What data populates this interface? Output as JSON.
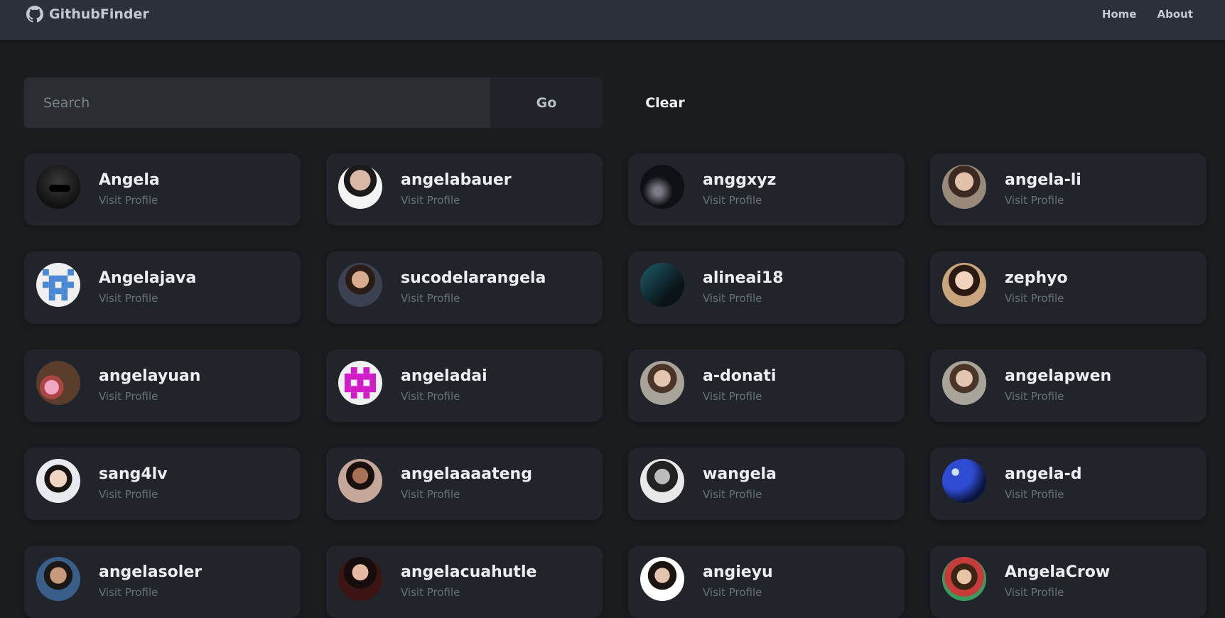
{
  "navbar": {
    "brand": "GithubFinder",
    "links": [
      {
        "label": "Home"
      },
      {
        "label": "About"
      }
    ]
  },
  "search": {
    "placeholder": "Search",
    "value": "",
    "go_label": "Go",
    "clear_label": "Clear"
  },
  "users": [
    {
      "login": "Angela",
      "link": "Visit Profile",
      "avatar": "photo-dark"
    },
    {
      "login": "angelabauer",
      "link": "Visit Profile",
      "avatar": "light"
    },
    {
      "login": "anggxyz",
      "link": "Visit Profile",
      "avatar": "night"
    },
    {
      "login": "angela-li",
      "link": "Visit Profile",
      "avatar": "portrait"
    },
    {
      "login": "Angelajava",
      "link": "Visit Profile",
      "avatar": "identicon-blue"
    },
    {
      "login": "sucodelarangela",
      "link": "Visit Profile",
      "avatar": "portrait2"
    },
    {
      "login": "alineai18",
      "link": "Visit Profile",
      "avatar": "teal"
    },
    {
      "login": "zephyo",
      "link": "Visit Profile",
      "avatar": "warm"
    },
    {
      "login": "angelayuan",
      "link": "Visit Profile",
      "avatar": "pink"
    },
    {
      "login": "angeladai",
      "link": "Visit Profile",
      "avatar": "identicon-magenta"
    },
    {
      "login": "a-donati",
      "link": "Visit Profile",
      "avatar": "soft"
    },
    {
      "login": "angelapwen",
      "link": "Visit Profile",
      "avatar": "soft"
    },
    {
      "login": "sang4lv",
      "link": "Visit Profile",
      "avatar": "kid"
    },
    {
      "login": "angelaaaateng",
      "link": "Visit Profile",
      "avatar": "smile"
    },
    {
      "login": "wangela",
      "link": "Visit Profile",
      "avatar": "bw"
    },
    {
      "login": "angela-d",
      "link": "Visit Profile",
      "avatar": "moon"
    },
    {
      "login": "angelasoler",
      "link": "Visit Profile",
      "avatar": "boy"
    },
    {
      "login": "angelacuahutle",
      "link": "Visit Profile",
      "avatar": "red"
    },
    {
      "login": "angieyu",
      "link": "Visit Profile",
      "avatar": "white"
    },
    {
      "login": "AngelaCrow",
      "link": "Visit Profile",
      "avatar": "colorful"
    }
  ],
  "colors": {
    "background": "#1b1c1f",
    "navbar": "#2b303a",
    "card": "#21242b",
    "identicon_blue": "#4a88d4",
    "identicon_magenta": "#d11ac8"
  }
}
